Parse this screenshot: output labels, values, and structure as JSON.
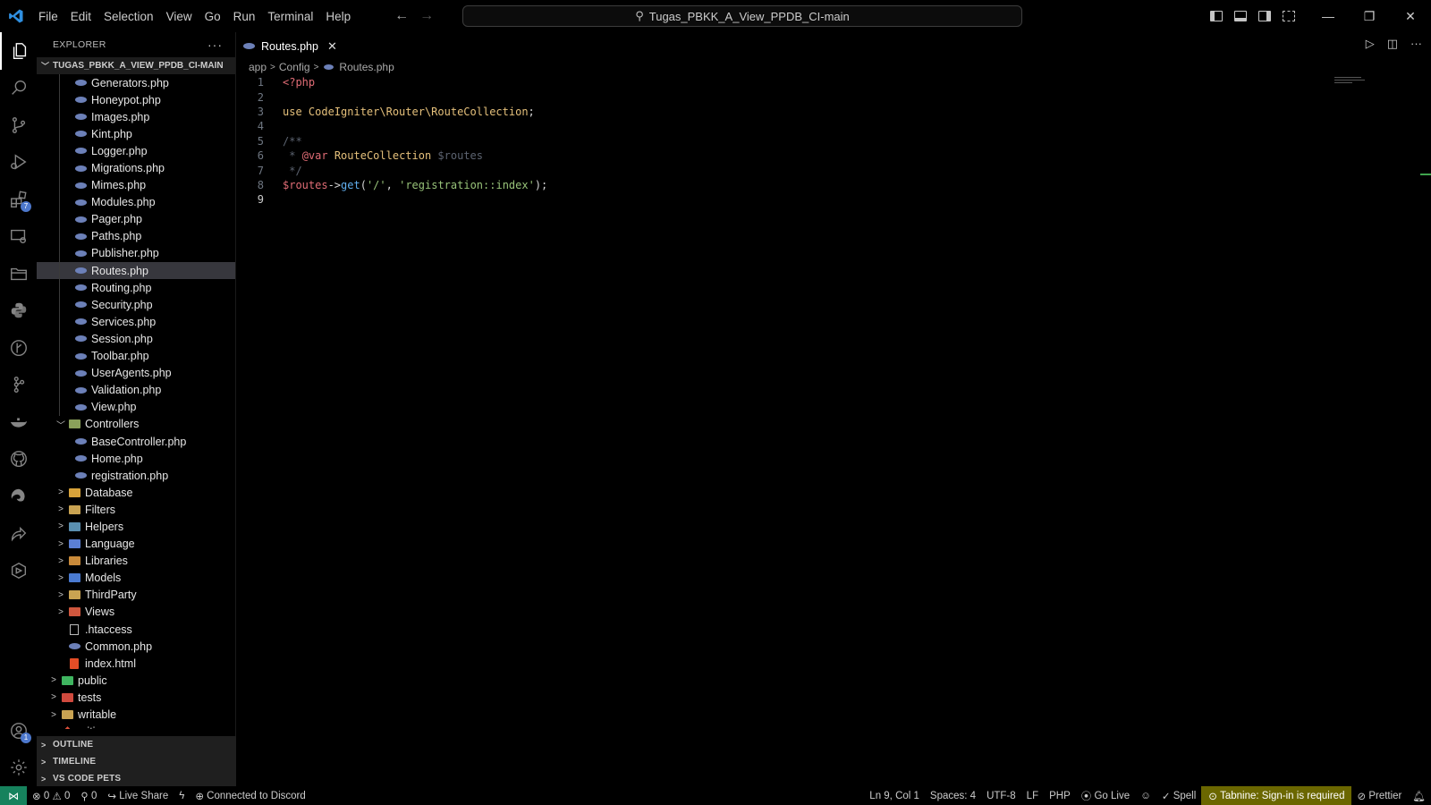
{
  "window": {
    "menu": [
      "File",
      "Edit",
      "Selection",
      "View",
      "Go",
      "Run",
      "Terminal",
      "Help"
    ],
    "search_text": "Tugas_PBKK_A_View_PPDB_CI-main"
  },
  "activity_bar": {
    "items": [
      {
        "name": "explorer-icon",
        "active": true
      },
      {
        "name": "search-icon"
      },
      {
        "name": "source-control-icon"
      },
      {
        "name": "run-debug-icon"
      },
      {
        "name": "extensions-icon",
        "badge": "7"
      },
      {
        "name": "remote-explorer-icon"
      },
      {
        "name": "project-manager-icon"
      },
      {
        "name": "python-icon"
      },
      {
        "name": "gitlens-icon"
      },
      {
        "name": "git-graph-icon"
      },
      {
        "name": "docker-icon"
      },
      {
        "name": "github-icon"
      },
      {
        "name": "edge-devtools-icon"
      },
      {
        "name": "live-share-icon"
      },
      {
        "name": "extension-pack-icon"
      }
    ],
    "accounts_badge": "1"
  },
  "sidebar": {
    "title": "EXPLORER",
    "more": "···",
    "root": "TUGAS_PBKK_A_VIEW_PPDB_CI-MAIN",
    "tree": [
      {
        "label": "Generators.php",
        "type": "php",
        "depth": 3
      },
      {
        "label": "Honeypot.php",
        "type": "php",
        "depth": 3
      },
      {
        "label": "Images.php",
        "type": "php",
        "depth": 3
      },
      {
        "label": "Kint.php",
        "type": "php",
        "depth": 3
      },
      {
        "label": "Logger.php",
        "type": "php",
        "depth": 3
      },
      {
        "label": "Migrations.php",
        "type": "php",
        "depth": 3
      },
      {
        "label": "Mimes.php",
        "type": "php",
        "depth": 3
      },
      {
        "label": "Modules.php",
        "type": "php",
        "depth": 3
      },
      {
        "label": "Pager.php",
        "type": "php",
        "depth": 3
      },
      {
        "label": "Paths.php",
        "type": "php",
        "depth": 3
      },
      {
        "label": "Publisher.php",
        "type": "php",
        "depth": 3
      },
      {
        "label": "Routes.php",
        "type": "php",
        "depth": 3,
        "selected": true
      },
      {
        "label": "Routing.php",
        "type": "php",
        "depth": 3
      },
      {
        "label": "Security.php",
        "type": "php",
        "depth": 3
      },
      {
        "label": "Services.php",
        "type": "php",
        "depth": 3
      },
      {
        "label": "Session.php",
        "type": "php",
        "depth": 3
      },
      {
        "label": "Toolbar.php",
        "type": "php",
        "depth": 3
      },
      {
        "label": "UserAgents.php",
        "type": "php",
        "depth": 3
      },
      {
        "label": "Validation.php",
        "type": "php",
        "depth": 3
      },
      {
        "label": "View.php",
        "type": "php",
        "depth": 3
      },
      {
        "label": "Controllers",
        "type": "folder",
        "depth": 2,
        "open": true,
        "color": "#8aa05a"
      },
      {
        "label": "BaseController.php",
        "type": "php",
        "depth": 3
      },
      {
        "label": "Home.php",
        "type": "php",
        "depth": 3
      },
      {
        "label": "registration.php",
        "type": "php",
        "depth": 3
      },
      {
        "label": "Database",
        "type": "folder",
        "depth": 2,
        "color": "#d8a33a"
      },
      {
        "label": "Filters",
        "type": "folder",
        "depth": 2,
        "color": "#c9a352"
      },
      {
        "label": "Helpers",
        "type": "folder",
        "depth": 2,
        "color": "#5a8fb0"
      },
      {
        "label": "Language",
        "type": "folder",
        "depth": 2,
        "color": "#5b7fd4"
      },
      {
        "label": "Libraries",
        "type": "folder",
        "depth": 2,
        "color": "#c98a3a"
      },
      {
        "label": "Models",
        "type": "folder",
        "depth": 2,
        "color": "#4a7ad0"
      },
      {
        "label": "ThirdParty",
        "type": "folder",
        "depth": 2,
        "color": "#c9a352"
      },
      {
        "label": "Views",
        "type": "folder",
        "depth": 2,
        "color": "#d0573e"
      },
      {
        "label": ".htaccess",
        "type": "file",
        "depth": 2
      },
      {
        "label": "Common.php",
        "type": "php",
        "depth": 2
      },
      {
        "label": "index.html",
        "type": "html",
        "depth": 2
      },
      {
        "label": "public",
        "type": "folder",
        "depth": 1,
        "color": "#3fb560"
      },
      {
        "label": "tests",
        "type": "folder",
        "depth": 1,
        "color": "#d04a3e"
      },
      {
        "label": "writable",
        "type": "folder",
        "depth": 1,
        "color": "#c9a352"
      },
      {
        "label": ".gitignore",
        "type": "git",
        "depth": 1
      }
    ],
    "sections": [
      "OUTLINE",
      "TIMELINE",
      "VS CODE PETS"
    ]
  },
  "editor": {
    "tab_label": "Routes.php",
    "breadcrumb": [
      "app",
      "Config",
      "Routes.php"
    ],
    "lines": [
      [
        {
          "t": "<?php",
          "c": "tk-php"
        }
      ],
      [],
      [
        {
          "t": "use ",
          "c": "tk-kw"
        },
        {
          "t": "CodeIgniter\\Router\\RouteCollection",
          "c": "tk-ns"
        },
        {
          "t": ";",
          "c": "tk-pun"
        }
      ],
      [],
      [
        {
          "t": "/**",
          "c": "tk-cm"
        }
      ],
      [
        {
          "t": " * ",
          "c": "tk-cm"
        },
        {
          "t": "@var",
          "c": "tk-var"
        },
        {
          "t": " ",
          "c": "tk-cm"
        },
        {
          "t": "RouteCollection",
          "c": "tk-tag"
        },
        {
          "t": " $routes",
          "c": "tk-cm"
        }
      ],
      [
        {
          "t": " */",
          "c": "tk-cm"
        }
      ],
      [
        {
          "t": "$routes",
          "c": "tk-var"
        },
        {
          "t": "->",
          "c": "tk-pun"
        },
        {
          "t": "get",
          "c": "tk-fn"
        },
        {
          "t": "(",
          "c": "tk-pun"
        },
        {
          "t": "'/'",
          "c": "tk-str"
        },
        {
          "t": ", ",
          "c": "tk-pun"
        },
        {
          "t": "'registration::index'",
          "c": "tk-str"
        },
        {
          "t": ");",
          "c": "tk-pun"
        }
      ],
      []
    ],
    "current_line": 9
  },
  "status_bar": {
    "errors": "0",
    "warnings": "0",
    "ports": "0",
    "live_share": "Live Share",
    "discord": "Connected to Discord",
    "cursor": "Ln 9, Col 1",
    "spaces": "Spaces: 4",
    "encoding": "UTF-8",
    "eol": "LF",
    "language": "PHP",
    "go_live": "Go Live",
    "spell": "Spell",
    "tabnine": "Tabnine: Sign-in is required",
    "prettier": "Prettier"
  }
}
